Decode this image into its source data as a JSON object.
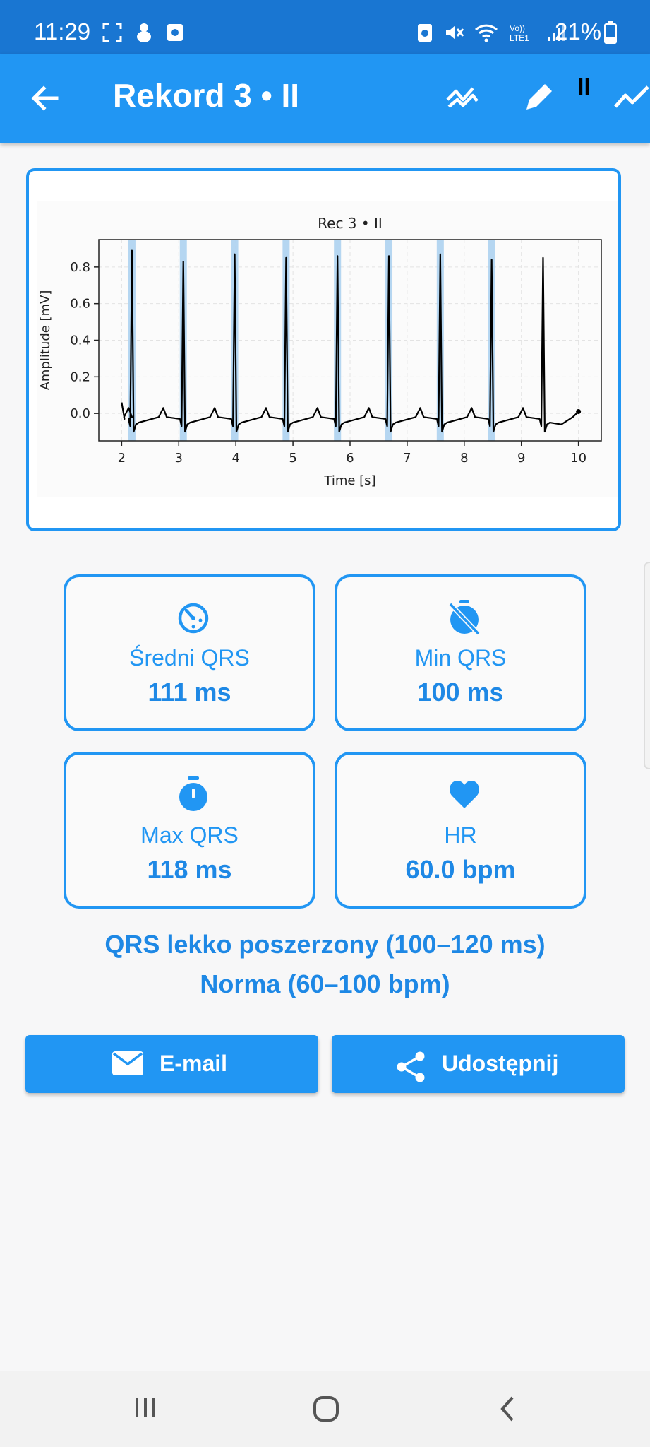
{
  "status_bar": {
    "time": "11:29",
    "battery": "21%",
    "icons": [
      "screenshot-icon",
      "animal-icon",
      "app-icon",
      "mute-icon",
      "wifi-icon",
      "volte-icon",
      "signal-icon",
      "battery-icon"
    ]
  },
  "app_bar": {
    "title": "Rekord 3 • II",
    "pause_label": "II",
    "actions": [
      "back-arrow-icon",
      "peaks-icon",
      "edit-pencil-icon",
      "trend-line-icon"
    ]
  },
  "chart_data": {
    "type": "line",
    "title": "Rec 3 • II",
    "xlabel": "Time [s]",
    "ylabel": "Amplitude [mV]",
    "xlim": [
      1.6,
      10.4
    ],
    "ylim": [
      -0.15,
      0.95
    ],
    "xticks": [
      2,
      3,
      4,
      5,
      6,
      7,
      8,
      9,
      10
    ],
    "yticks": [
      0.0,
      0.2,
      0.4,
      0.6,
      0.8
    ],
    "grid": true,
    "series": [
      {
        "color": "#000000",
        "peaks_t": [
          2.18,
          3.08,
          3.98,
          4.88,
          5.78,
          6.68,
          7.58,
          8.48,
          9.38
        ],
        "peaks_amp": [
          0.89,
          0.83,
          0.87,
          0.85,
          0.86,
          0.86,
          0.87,
          0.84,
          0.85
        ],
        "baseline": -0.02,
        "end_t": 10.0
      }
    ],
    "qrs_markers": {
      "color": "#a8cfee",
      "t": [
        2.18,
        3.08,
        3.98,
        4.88,
        5.78,
        6.68,
        7.58,
        8.48
      ]
    }
  },
  "stats": [
    {
      "icon": "timer-icon",
      "label": "Średni QRS",
      "value": "111 ms"
    },
    {
      "icon": "timer-off-icon",
      "label": "Min QRS",
      "value": "100 ms"
    },
    {
      "icon": "stopwatch-icon",
      "label": "Max QRS",
      "value": "118 ms"
    },
    {
      "icon": "heart-icon",
      "label": "HR",
      "value": "60.0 bpm"
    }
  ],
  "assessment": {
    "qrs": "QRS lekko poszerzony (100–120 ms)",
    "hr": "Norma (60–100 bpm)"
  },
  "buttons": {
    "email": "E-mail",
    "share": "Udostępnij"
  },
  "colors": {
    "primary": "#2196f3",
    "status_bar": "#1976d2",
    "text_accent": "#1e88e5"
  }
}
